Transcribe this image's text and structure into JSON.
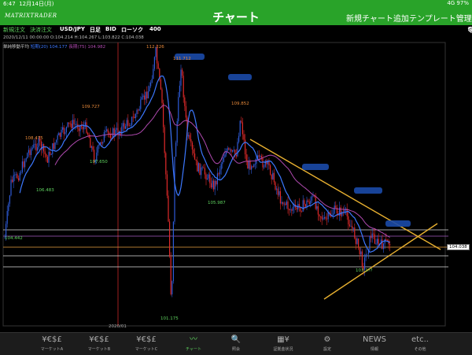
{
  "status": {
    "time": "6:47",
    "date": "12月14日(月)",
    "network": "4G 97%"
  },
  "header": {
    "logo": "MATRIXTRADER",
    "title": "チャート",
    "add_chart": "新規チャート追加",
    "template": "テンプレート管理"
  },
  "toolbar": {
    "new_order": "新規注文",
    "settle_order": "決済注文",
    "pair": "USD/JPY",
    "period": "日足",
    "side": "BID",
    "chart_type": "ローソク",
    "bars": "400",
    "icons": [
      "pencil-icon",
      "gear-icon",
      "more-icon"
    ]
  },
  "ohlc": "2020/12/11 00:00:00  O:104.214  H:104.267  L:103.822  C:104.038",
  "chart": {
    "ma_title": "単純移動平均",
    "ma_short": "短期(20) 104.177",
    "ma_long": "長期(75) 104.982",
    "current_price": "104.038",
    "date_label": "2020/01",
    "price_labels": [
      "112.226",
      "111.712",
      "109.852",
      "109.727",
      "108.475",
      "107.650",
      "106.483",
      "105.987",
      "104.442",
      "103.1??",
      "101.175"
    ],
    "colors": {
      "bull": "#2e5bd8",
      "bear": "#e02a2a",
      "ma_short": "#3c78ff",
      "ma_long": "#b04ab0",
      "trend": "#e8b030"
    }
  },
  "tabs": [
    {
      "icon": "¥€$£",
      "label": "マーケットA"
    },
    {
      "icon": "¥€$£",
      "label": "マーケットB"
    },
    {
      "icon": "¥€$£",
      "label": "マーケットC"
    },
    {
      "icon": "〰",
      "label": "チャート"
    },
    {
      "icon": "🔍",
      "label": "照会"
    },
    {
      "icon": "▦¥",
      "label": "証拠金状況"
    },
    {
      "icon": "⚙",
      "label": "設定"
    },
    {
      "icon": "NEWS",
      "label": "情報"
    },
    {
      "icon": "etc..",
      "label": "その他"
    }
  ]
}
